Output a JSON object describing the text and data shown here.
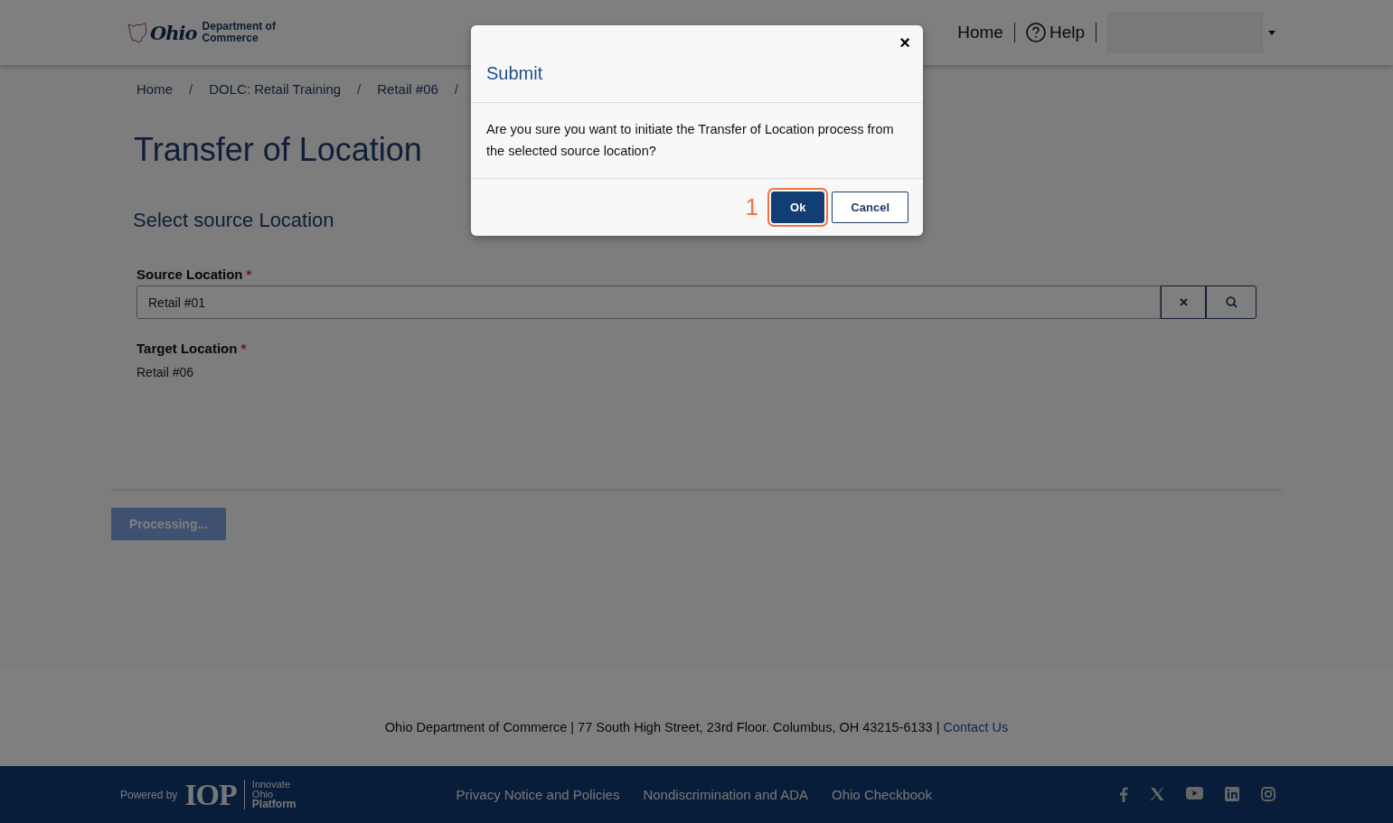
{
  "header": {
    "logo_script": "Ohio",
    "logo_text": [
      "Department of",
      "Commerce"
    ],
    "nav": [
      {
        "label": "Home",
        "kind": "link"
      },
      {
        "label": "Help",
        "kind": "help"
      }
    ]
  },
  "breadcrumb": [
    {
      "label": "Home",
      "separator": "/"
    },
    {
      "label": "DOLC: Retail Training",
      "separator": "/"
    },
    {
      "label": "Retail #06",
      "separator": "/"
    }
  ],
  "page_title": "Transfer of Location",
  "section_title": "Select source Location",
  "source_location": {
    "label": "Source Location",
    "required_mark": "*",
    "value": "Retail #01"
  },
  "target_location": {
    "label": "Target Location",
    "required_mark": "*",
    "value": "Retail #06"
  },
  "processing_button": {
    "label": "Processing...",
    "disabled": true
  },
  "footer": {
    "address": "Ohio Department of Commerce | 77 South High Street, 23rd Floor. Columbus, OH 43215-6133 |",
    "contact_link": "Contact Us",
    "powered_by": "Powered by",
    "platform_logo": "IOP",
    "platform_name": [
      "Innovate",
      "Ohio",
      "Platform"
    ],
    "links": [
      "Privacy Notice and Policies",
      "Nondiscrimination and ADA",
      "Ohio Checkbook"
    ],
    "social": [
      {
        "kind": "facebook"
      },
      {
        "kind": "x"
      },
      {
        "kind": "youtube"
      },
      {
        "kind": "linkedin"
      },
      {
        "kind": "instagram"
      }
    ]
  },
  "modal": {
    "title": "Submit",
    "close": "×",
    "message": "Are you sure you want to initiate the Transfer of Location process from the selected source location?",
    "annotation": "1",
    "buttons": [
      {
        "label": "Ok",
        "kind": "primary",
        "highlighted": true
      },
      {
        "label": "Cancel",
        "kind": "secondary",
        "highlighted": false
      }
    ]
  }
}
